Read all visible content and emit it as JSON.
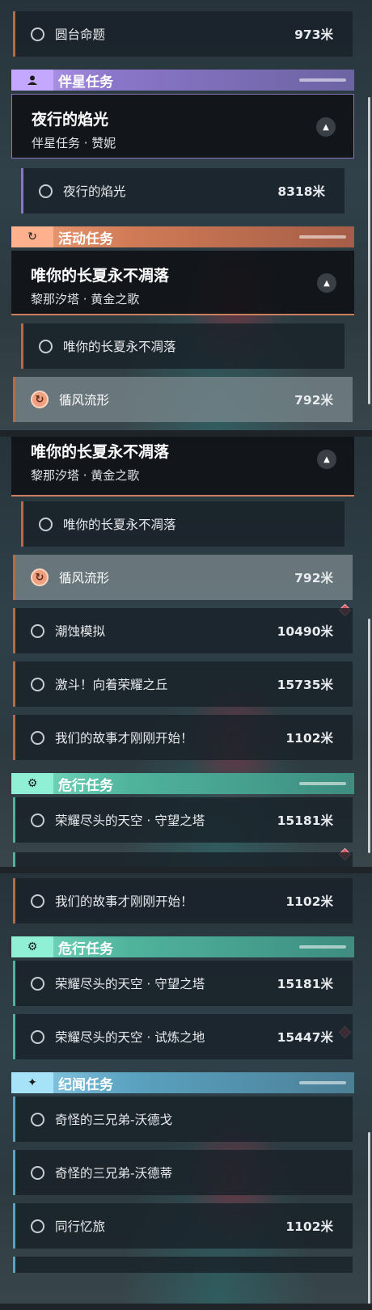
{
  "panel1": {
    "row_yuantai": {
      "name": "圆台命题",
      "distance": "973米"
    },
    "companion_header": {
      "title": "伴星任务",
      "icon": "person-icon"
    },
    "companion_quest": {
      "title": "夜行的焰光",
      "subtitle": "伴星任务 · 赞妮"
    },
    "companion_step": {
      "name": "夜行的焰光",
      "distance": "8318米"
    },
    "event_header": {
      "title": "活动任务",
      "icon": "cycle-icon"
    },
    "event_quest": {
      "title": "唯你的长夏永不凋落",
      "subtitle": "黎那汐塔 · 黄金之歌"
    },
    "event_step": {
      "name": "唯你的长夏永不凋落"
    },
    "selected_row": {
      "name": "循风流形",
      "distance": "792米"
    }
  },
  "panel2": {
    "event_quest": {
      "title": "唯你的长夏永不凋落",
      "subtitle": "黎那汐塔 · 黄金之歌"
    },
    "event_step": {
      "name": "唯你的长夏永不凋落"
    },
    "selected_row": {
      "name": "循风流形",
      "distance": "792米"
    },
    "rows": [
      {
        "name": "潮蚀模拟",
        "distance": "10490米"
      },
      {
        "name": "激斗！向着荣耀之丘",
        "distance": "15735米"
      },
      {
        "name": "我们的故事才刚刚开始！",
        "distance": "1102米"
      }
    ],
    "danger_header": {
      "title": "危行任务",
      "icon": "danger-icon"
    },
    "danger_row": {
      "name": "荣耀尽头的天空 · 守望之塔",
      "distance": "15181米"
    }
  },
  "panel3": {
    "story_row": {
      "name": "我们的故事才刚刚开始！",
      "distance": "1102米"
    },
    "danger_header": {
      "title": "危行任务",
      "icon": "danger-icon"
    },
    "danger_rows": [
      {
        "name": "荣耀尽头的天空 · 守望之塔",
        "distance": "15181米"
      },
      {
        "name": "荣耀尽头的天空 · 试炼之地",
        "distance": "15447米"
      }
    ],
    "lore_header": {
      "title": "纪闻任务",
      "icon": "sparkle-icon"
    },
    "lore_rows": [
      {
        "name": "奇怪的三兄弟-沃德戈",
        "distance": ""
      },
      {
        "name": "奇怪的三兄弟-沃德蒂",
        "distance": ""
      },
      {
        "name": "同行忆旅",
        "distance": "1102米"
      }
    ]
  },
  "colors": {
    "event_accent": "#c9805e",
    "companion_accent": "#b99ef0",
    "danger_accent": "#4fb39c",
    "lore_accent": "#5aa2c0",
    "tracked_marker": "#d5545f"
  }
}
